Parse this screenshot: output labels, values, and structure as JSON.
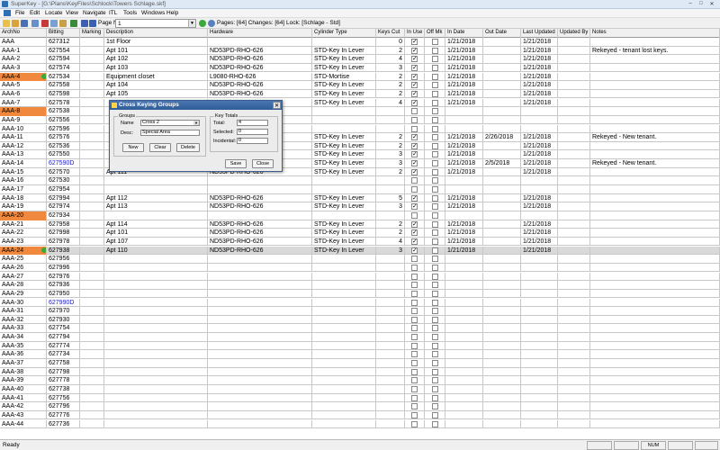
{
  "window": {
    "title": "SuperKey - [G:\\Plans\\KeyFiles\\Schlock\\Towers Schlage.skf]",
    "minimize": "–",
    "maximize": "□",
    "close": "✕"
  },
  "menu": [
    "File",
    "Edit",
    "Locate",
    "View",
    "Navigate",
    "ITL",
    "Tools",
    "Windows",
    "Help"
  ],
  "toolbar": {
    "page_label": "Page No:",
    "page_value": "1",
    "status_text": "Pages: [64]  Changes: [64]  Lock: [Schlage - Std]"
  },
  "columns": [
    "ArchNo",
    "Bitting",
    "Marking",
    "Description",
    "Hardware",
    "Cylinder Type",
    "Keys Cut",
    "In Use",
    "Off Mk",
    "In Date",
    "Out Date",
    "Last Updated",
    "Updated By",
    "Notes"
  ],
  "rows": [
    {
      "arch": "AAA",
      "bitting": "627312",
      "desc": "1st Floor",
      "hw": "",
      "cyl": "",
      "keys": "0",
      "inuse": true,
      "offmk": false,
      "indate": "1/21/2018",
      "outdate": "",
      "updated": "1/21/2018",
      "notes": ""
    },
    {
      "arch": "AAA-1",
      "bitting": "627554",
      "desc": "Apt 101",
      "hw": "ND53PD-RHO-626",
      "cyl": "STD-Key In Lever",
      "keys": "2",
      "inuse": true,
      "offmk": false,
      "indate": "1/21/2018",
      "outdate": "",
      "updated": "1/21/2018",
      "notes": "Rekeyed - tenant lost keys."
    },
    {
      "arch": "AAA-2",
      "bitting": "627594",
      "desc": "Apt 102",
      "hw": "ND53PD-RHO-626",
      "cyl": "STD-Key In Lever",
      "keys": "4",
      "inuse": true,
      "offmk": false,
      "indate": "1/21/2018",
      "outdate": "",
      "updated": "1/21/2018",
      "notes": ""
    },
    {
      "arch": "AAA-3",
      "bitting": "627574",
      "desc": "Apt 103",
      "hw": "ND53PD-RHO-626",
      "cyl": "STD-Key In Lever",
      "keys": "3",
      "inuse": true,
      "offmk": false,
      "indate": "1/21/2018",
      "outdate": "",
      "updated": "1/21/2018",
      "notes": ""
    },
    {
      "arch": "AAA-4",
      "bitting": "627534",
      "desc": "Equipment closet",
      "hw": "L9080-RHO-626",
      "cyl": "STD-Mortise",
      "keys": "2",
      "inuse": true,
      "offmk": false,
      "indate": "1/21/2018",
      "outdate": "",
      "updated": "1/21/2018",
      "notes": "",
      "hl": true,
      "mark": true
    },
    {
      "arch": "AAA-5",
      "bitting": "627558",
      "desc": "Apt 104",
      "hw": "ND53PD-RHO-626",
      "cyl": "STD-Key In Lever",
      "keys": "2",
      "inuse": true,
      "offmk": false,
      "indate": "1/21/2018",
      "outdate": "",
      "updated": "1/21/2018",
      "notes": ""
    },
    {
      "arch": "AAA-6",
      "bitting": "627598",
      "desc": "Apt 105",
      "hw": "ND53PD-RHO-626",
      "cyl": "STD-Key In Lever",
      "keys": "2",
      "inuse": true,
      "offmk": false,
      "indate": "1/21/2018",
      "outdate": "",
      "updated": "1/21/2018",
      "notes": ""
    },
    {
      "arch": "AAA-7",
      "bitting": "627578",
      "desc": "",
      "hw": "",
      "cyl": "STD-Key In Lever",
      "keys": "4",
      "inuse": true,
      "offmk": false,
      "indate": "1/21/2018",
      "outdate": "",
      "updated": "1/21/2018",
      "notes": ""
    },
    {
      "arch": "AAA-8",
      "bitting": "627538",
      "desc": "",
      "hw": "",
      "cyl": "",
      "keys": "",
      "inuse": false,
      "offmk": false,
      "indate": "",
      "outdate": "",
      "updated": "",
      "notes": "",
      "hl": true
    },
    {
      "arch": "AAA-9",
      "bitting": "627556",
      "desc": "",
      "hw": "",
      "cyl": "",
      "keys": "",
      "inuse": false,
      "offmk": false,
      "indate": "",
      "outdate": "",
      "updated": "",
      "notes": ""
    },
    {
      "arch": "AAA-10",
      "bitting": "627596",
      "desc": "",
      "hw": "",
      "cyl": "",
      "keys": "",
      "inuse": false,
      "offmk": false,
      "indate": "",
      "outdate": "",
      "updated": "",
      "notes": ""
    },
    {
      "arch": "AAA-11",
      "bitting": "627576",
      "desc": "",
      "hw": "",
      "cyl": "STD-Key In Lever",
      "keys": "2",
      "inuse": true,
      "offmk": false,
      "indate": "1/21/2018",
      "outdate": "2/26/2018",
      "updated": "1/21/2018",
      "notes": "Rekeyed - New tenant."
    },
    {
      "arch": "AAA-12",
      "bitting": "627536",
      "desc": "",
      "hw": "",
      "cyl": "STD-Key In Lever",
      "keys": "2",
      "inuse": true,
      "offmk": false,
      "indate": "1/21/2018",
      "outdate": "",
      "updated": "1/21/2018",
      "notes": ""
    },
    {
      "arch": "AAA-13",
      "bitting": "627550",
      "desc": "",
      "hw": "",
      "cyl": "STD-Key In Lever",
      "keys": "3",
      "inuse": true,
      "offmk": false,
      "indate": "1/21/2018",
      "outdate": "",
      "updated": "1/21/2018",
      "notes": ""
    },
    {
      "arch": "AAA-14",
      "bitting": "627590D",
      "desc": "",
      "hw": "",
      "cyl": "STD-Key In Lever",
      "keys": "3",
      "inuse": true,
      "offmk": false,
      "indate": "1/21/2018",
      "outdate": "2/5/2018",
      "updated": "1/21/2018",
      "notes": "Rekeyed - New tenant.",
      "blue": true
    },
    {
      "arch": "AAA-15",
      "bitting": "627570",
      "desc": "Apt 111",
      "hw": "ND53PD-RHO-626",
      "cyl": "STD-Key In Lever",
      "keys": "2",
      "inuse": true,
      "offmk": false,
      "indate": "1/21/2018",
      "outdate": "",
      "updated": "1/21/2018",
      "notes": ""
    },
    {
      "arch": "AAA-16",
      "bitting": "627530",
      "desc": "",
      "hw": "",
      "cyl": "",
      "keys": "",
      "inuse": false,
      "offmk": false,
      "indate": "",
      "outdate": "",
      "updated": "",
      "notes": ""
    },
    {
      "arch": "AAA-17",
      "bitting": "627954",
      "desc": "",
      "hw": "",
      "cyl": "",
      "keys": "",
      "inuse": false,
      "offmk": false,
      "indate": "",
      "outdate": "",
      "updated": "",
      "notes": ""
    },
    {
      "arch": "AAA-18",
      "bitting": "627994",
      "desc": "Apt 112",
      "hw": "ND53PD-RHO-626",
      "cyl": "STD-Key In Lever",
      "keys": "5",
      "inuse": true,
      "offmk": false,
      "indate": "1/21/2018",
      "outdate": "",
      "updated": "1/21/2018",
      "notes": ""
    },
    {
      "arch": "AAA-19",
      "bitting": "627974",
      "desc": "Apt 113",
      "hw": "ND53PD-RHO-626",
      "cyl": "STD-Key In Lever",
      "keys": "3",
      "inuse": true,
      "offmk": false,
      "indate": "1/21/2018",
      "outdate": "",
      "updated": "1/21/2018",
      "notes": ""
    },
    {
      "arch": "AAA-20",
      "bitting": "627934",
      "desc": "",
      "hw": "",
      "cyl": "",
      "keys": "",
      "inuse": false,
      "offmk": false,
      "indate": "",
      "outdate": "",
      "updated": "",
      "notes": "",
      "hl": true
    },
    {
      "arch": "AAA-21",
      "bitting": "627958",
      "desc": "Apt 114",
      "hw": "ND53PD-RHO-626",
      "cyl": "STD-Key In Lever",
      "keys": "2",
      "inuse": true,
      "offmk": false,
      "indate": "1/21/2018",
      "outdate": "",
      "updated": "1/21/2018",
      "notes": ""
    },
    {
      "arch": "AAA-22",
      "bitting": "627998",
      "desc": "Apt 101",
      "hw": "ND53PD-RHO-626",
      "cyl": "STD-Key In Lever",
      "keys": "2",
      "inuse": true,
      "offmk": false,
      "indate": "1/21/2018",
      "outdate": "",
      "updated": "1/21/2018",
      "notes": ""
    },
    {
      "arch": "AAA-23",
      "bitting": "627978",
      "desc": "Apt 107",
      "hw": "ND53PD-RHO-626",
      "cyl": "STD-Key In Lever",
      "keys": "4",
      "inuse": true,
      "offmk": false,
      "indate": "1/21/2018",
      "outdate": "",
      "updated": "1/21/2018",
      "notes": ""
    },
    {
      "arch": "AAA-24",
      "bitting": "627938",
      "desc": "Apt 110",
      "hw": "ND53PD-RHO-626",
      "cyl": "STD-Key In Lever",
      "keys": "3",
      "inuse": true,
      "offmk": false,
      "indate": "1/21/2018",
      "outdate": "",
      "updated": "1/21/2018",
      "notes": "",
      "hl": true,
      "mark": true,
      "sel": true
    },
    {
      "arch": "AAA-25",
      "bitting": "627956"
    },
    {
      "arch": "AAA-26",
      "bitting": "627996"
    },
    {
      "arch": "AAA-27",
      "bitting": "627976"
    },
    {
      "arch": "AAA-28",
      "bitting": "627936"
    },
    {
      "arch": "AAA-29",
      "bitting": "627950"
    },
    {
      "arch": "AAA-30",
      "bitting": "627990D",
      "blue": true
    },
    {
      "arch": "AAA-31",
      "bitting": "627970"
    },
    {
      "arch": "AAA-32",
      "bitting": "627930"
    },
    {
      "arch": "AAA-33",
      "bitting": "627754"
    },
    {
      "arch": "AAA-34",
      "bitting": "627794"
    },
    {
      "arch": "AAA-35",
      "bitting": "627774"
    },
    {
      "arch": "AAA-36",
      "bitting": "627734"
    },
    {
      "arch": "AAA-37",
      "bitting": "627758"
    },
    {
      "arch": "AAA-38",
      "bitting": "627798"
    },
    {
      "arch": "AAA-39",
      "bitting": "627778"
    },
    {
      "arch": "AAA-40",
      "bitting": "627738"
    },
    {
      "arch": "AAA-41",
      "bitting": "627756"
    },
    {
      "arch": "AAA-42",
      "bitting": "627796"
    },
    {
      "arch": "AAA-43",
      "bitting": "627776"
    },
    {
      "arch": "AAA-44",
      "bitting": "627736"
    }
  ],
  "dialog": {
    "title": "Cross Keying Groups",
    "groups_legend": "Groups",
    "name_label": "Name",
    "name_value": "Cross 2",
    "desc_label": "Desc:",
    "desc_value": "Special Area",
    "key_totals_legend": "Key Totals",
    "total_label": "Total:",
    "total_value": "4",
    "selected_label": "Selected:",
    "selected_value": "0",
    "incidental_label": "Incidental:",
    "incidental_value": "0",
    "new_btn": "New",
    "clear_btn": "Clear",
    "delete_btn": "Delete",
    "save_btn": "Save",
    "close_btn": "Close"
  },
  "status": {
    "text": "Ready",
    "num": "NUM"
  },
  "colors": {
    "highlight": "#f0883e",
    "mark_ok": "#3aa83a",
    "blue_text": "#1a1ac0"
  }
}
